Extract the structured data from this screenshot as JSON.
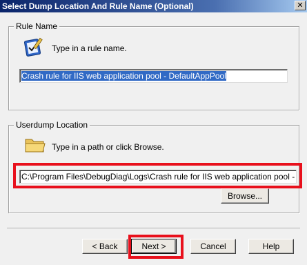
{
  "window": {
    "title": "Select Dump Location And Rule Name (Optional)",
    "close_glyph": "✕"
  },
  "rule_name": {
    "group_label": "Rule Name",
    "hint": "Type in a rule name.",
    "value": "Crash rule for IIS web application pool - DefaultAppPool",
    "icon": "notepad-check-icon"
  },
  "userdump": {
    "group_label": "Userdump Location",
    "hint": "Type in a path or click Browse.",
    "path": "C:\\Program Files\\DebugDiag\\Logs\\Crash rule for IIS web application pool - DefaultAppPool",
    "browse_label": "Browse...",
    "icon": "folder-icon"
  },
  "footer": {
    "back_label": "< Back",
    "next_label": "Next >",
    "cancel_label": "Cancel",
    "help_label": "Help"
  },
  "colors": {
    "annotation_red": "#e8101c",
    "selection_blue": "#316ac5",
    "title_blue": "#0a246a"
  }
}
